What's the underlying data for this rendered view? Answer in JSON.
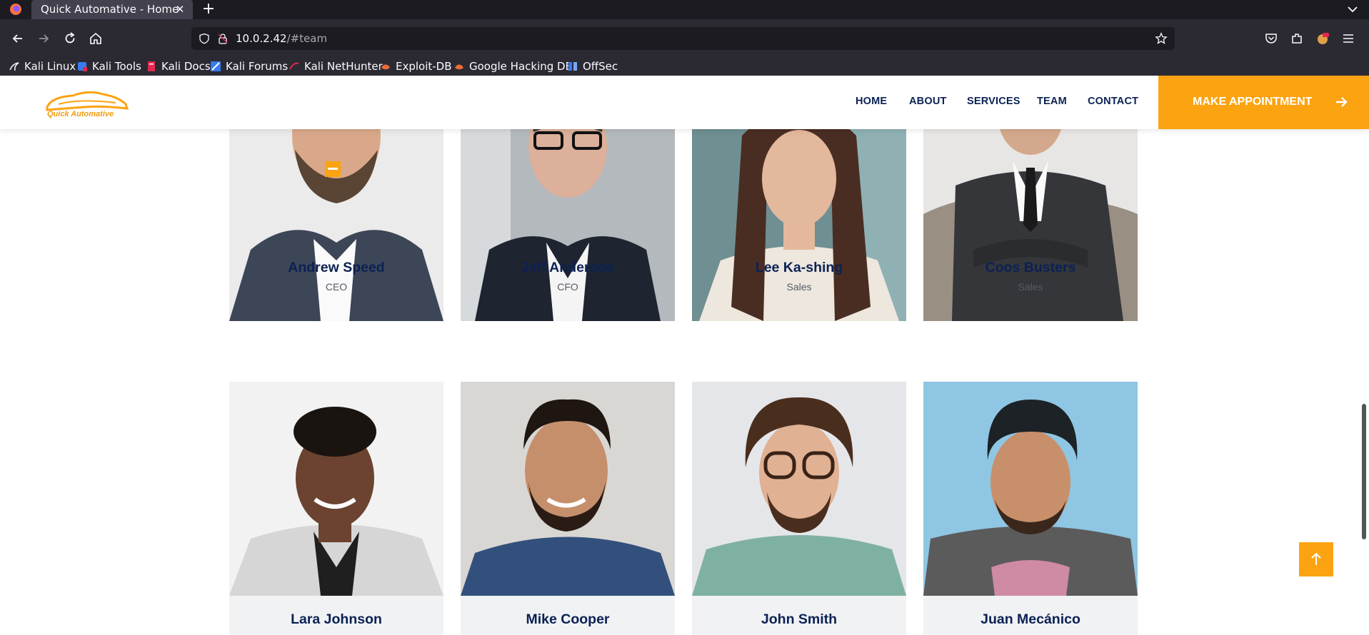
{
  "browser": {
    "tab_title": "Quick Automative - Home",
    "url_host": "10.0.2.42",
    "url_path": "/#team",
    "bookmarks": [
      "Kali Linux",
      "Kali Tools",
      "Kali Docs",
      "Kali Forums",
      "Kali NetHunter",
      "Exploit-DB",
      "Google Hacking DB",
      "OffSec"
    ]
  },
  "site": {
    "logo_text": "Quick Automative",
    "menu": [
      "HOME",
      "ABOUT",
      "SERVICES",
      "TEAM",
      "CONTACT"
    ],
    "cta_label": "MAKE APPOINTMENT",
    "colors": {
      "accent": "#fca311",
      "navy": "#0b2154",
      "card_bg": "#f1f2f4"
    }
  },
  "team": [
    {
      "name": "Andrew Speed",
      "role": "CEO"
    },
    {
      "name": "Jeff Anderson",
      "role": "CFO"
    },
    {
      "name": "Lee Ka-shing",
      "role": "Sales"
    },
    {
      "name": "Coos Busters",
      "role": "Sales"
    },
    {
      "name": "Lara Johnson",
      "role": ""
    },
    {
      "name": "Mike Cooper",
      "role": ""
    },
    {
      "name": "John Smith",
      "role": ""
    },
    {
      "name": "Juan Mecánico",
      "role": ""
    }
  ],
  "icons": {
    "back": "arrow-left-icon",
    "forward": "arrow-right-icon",
    "reload": "reload-icon",
    "home": "home-icon",
    "scroll_top": "arrow-up-icon"
  }
}
